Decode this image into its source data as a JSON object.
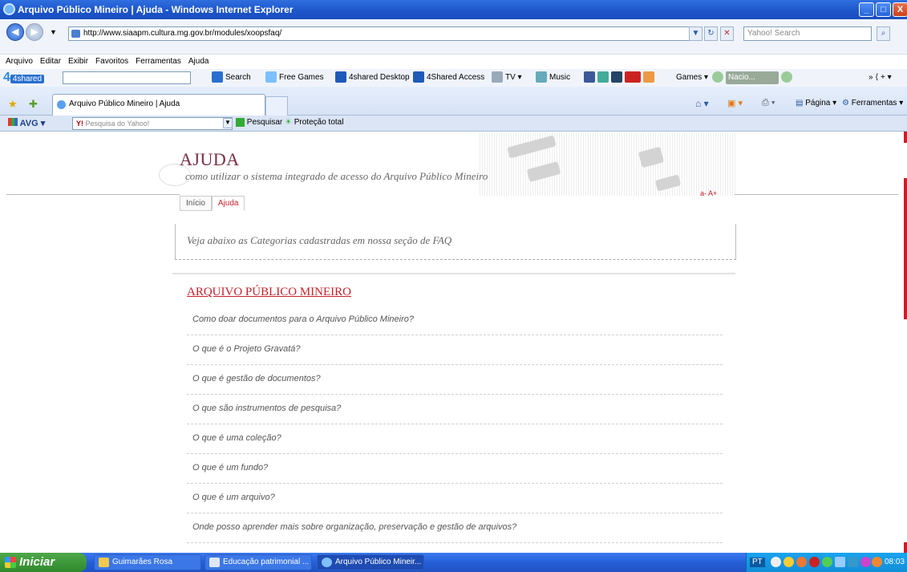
{
  "window": {
    "title": "Arquivo Público Mineiro | Ajuda - Windows Internet Explorer",
    "min_label": "_",
    "max_label": "□",
    "close_label": "X"
  },
  "address": {
    "url": "http://www.siaapm.cultura.mg.gov.br/modules/xoopsfaq/",
    "search_placeholder": "Yahoo! Search"
  },
  "menu": [
    "Arquivo",
    "Editar",
    "Exibir",
    "Favoritos",
    "Ferramentas",
    "Ajuda"
  ],
  "toolbar": {
    "brand": "4shared",
    "search": "Search",
    "free_games": "Free Games",
    "desktop": "4shared Desktop",
    "access": "4Shared Access",
    "tv": "TV",
    "music": "Music",
    "games": "Games",
    "radio": "Nacio..."
  },
  "tabs": {
    "active": "Arquivo Público Mineiro | Ajuda",
    "page_label": "Página",
    "tools_label": "Ferramentas"
  },
  "avg": {
    "brand": "AVG",
    "search_placeholder": "Pesquisa do Yahoo!",
    "search_button": "Pesquisar",
    "protection": "Proteção total"
  },
  "page": {
    "title": "AJUDA",
    "subtitle": "como utilizar o sistema integrado de acesso do Arquivo Público Mineiro",
    "font_controls": "a-  A+",
    "nav": [
      {
        "label": "Início"
      },
      {
        "label": "Ajuda"
      }
    ],
    "notice": "Veja abaixo as Categorias cadastradas em nossa seção de FAQ",
    "category": "ARQUIVO PÚBLICO MINEIRO",
    "questions": [
      "Como doar documentos para o Arquivo Público Mineiro?",
      "O que é o Projeto Gravatá?",
      "O que é gestão de documentos?",
      "O que são instrumentos de pesquisa?",
      "O que é uma coleção?",
      "O que é um fundo?",
      "O que é um arquivo?",
      "Onde posso aprender mais sobre organização, preservação e gestão de arquivos?"
    ]
  },
  "taskbar": {
    "start": "Iniciar",
    "tasks": [
      "Guimarães Rosa",
      "Educação patrimonial ...",
      "Arquivo Público Mineir..."
    ],
    "lang": "PT",
    "time": "08:03"
  }
}
